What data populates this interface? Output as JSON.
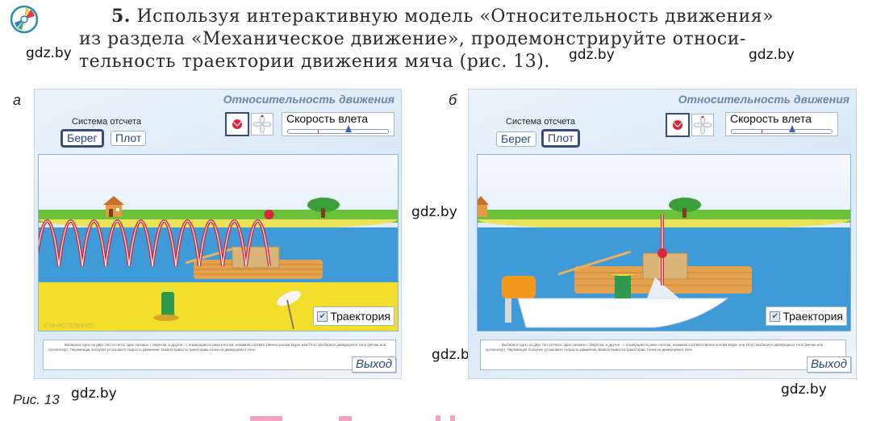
{
  "task": {
    "number": "5.",
    "line1": "Используя интерактивную модель «Относительность движения»",
    "line2": "из раздела «Механическое движение», продемонстрируйте относи-",
    "line3": "тельность траектории движения мяча (рис. 13)."
  },
  "watermark": "gdz.by",
  "figure": {
    "caption": "Рис. 13",
    "panels": [
      {
        "label": "а",
        "app_title": "Относительность движения",
        "frame_label": "Система отсчета",
        "frame_buttons": [
          {
            "label": "Берег",
            "active": true
          },
          {
            "label": "Плот",
            "active": false
          }
        ],
        "tools": [
          {
            "icon": "ball-icon",
            "active": true
          },
          {
            "icon": "propeller-icon",
            "active": false
          }
        ],
        "speed_label": "Скорость влета",
        "speed_value_fraction": 0.6,
        "trajectory_label": "Траектория",
        "trajectory_checked": true,
        "trajectory_shape": "bouncing-arcs",
        "copyright": "© ИНФОТЕЛЕФИЗ",
        "instructions": "Выберите одно из двух тел отсчета: одно связано с берегом, а другое - с плывущим по реке плотом, нажимая соответственно кнопки Берег или Плот. Выберите движущееся тело (мячик или пропеллер). Перемещая ползунок установите скорость движения. Можно вывести траекторию точки на движущемся теле.",
        "exit_label": "Выход"
      },
      {
        "label": "б",
        "app_title": "Относительность движения",
        "frame_label": "Система отсчета",
        "frame_buttons": [
          {
            "label": "Берег",
            "active": false
          },
          {
            "label": "Плот",
            "active": true
          }
        ],
        "tools": [
          {
            "icon": "ball-icon",
            "active": true
          },
          {
            "icon": "propeller-icon",
            "active": false
          }
        ],
        "speed_label": "Скорость влета",
        "speed_value_fraction": 0.6,
        "trajectory_label": "Траектория",
        "trajectory_checked": true,
        "trajectory_shape": "vertical-line",
        "instructions": "Выберите одно из двух тел отсчета: одно связано с берегом, а другое - с плывущим по реке плотом, нажимая соответственно кнопки Берег или Плот. Выберите движущееся тело (мячик или пропеллер). Перемещая ползунок установите скорость движения. Можно вывести траекторию точки на движущемся теле.",
        "exit_label": "Выход"
      }
    ]
  },
  "colors": {
    "water": "#3f9ad8",
    "grass": "#6cc13a",
    "sand": "#f3de2c",
    "trajectory": "#d8263a",
    "button_text": "#2b4a7c",
    "title_text": "#6c87a6"
  }
}
